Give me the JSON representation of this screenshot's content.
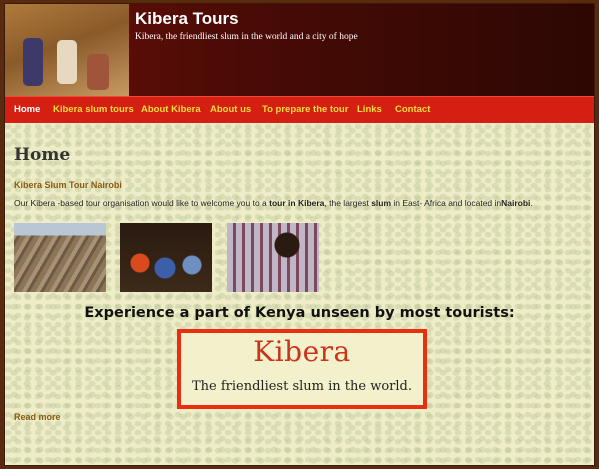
{
  "header": {
    "site_title": "Kibera Tours",
    "tagline": "Kibera, the friendliest slum in the world and a city of hope"
  },
  "nav": {
    "items": [
      {
        "label": "Home",
        "active": true
      },
      {
        "label": "Kibera slum tours"
      },
      {
        "label": "About Kibera"
      },
      {
        "label": "About us"
      },
      {
        "label": "To prepare the tour"
      },
      {
        "label": "Links"
      },
      {
        "label": "Contact"
      }
    ]
  },
  "main": {
    "page_title": "Home",
    "subtitle": "Kibera Slum Tour Nairobi",
    "intro": {
      "p1": "Our Kibera -based tour organisation would like to welcome you to a ",
      "b1": "tour in Kibera",
      "p2": ", the largest ",
      "b2": "slum",
      "p3": " in East- Africa and located in",
      "b3": "Nairobi",
      "p4": "."
    },
    "headline": "Experience a part of Kenya unseen by most tourists:",
    "banner": {
      "title": "Kibera",
      "subtitle": "The friendliest slum in the world."
    },
    "read_more": "Read more"
  },
  "colors": {
    "nav_bg": "#d51f13",
    "nav_text": "#f2dd3a",
    "accent_brown": "#8a5a12",
    "banner_border": "#e83010"
  }
}
